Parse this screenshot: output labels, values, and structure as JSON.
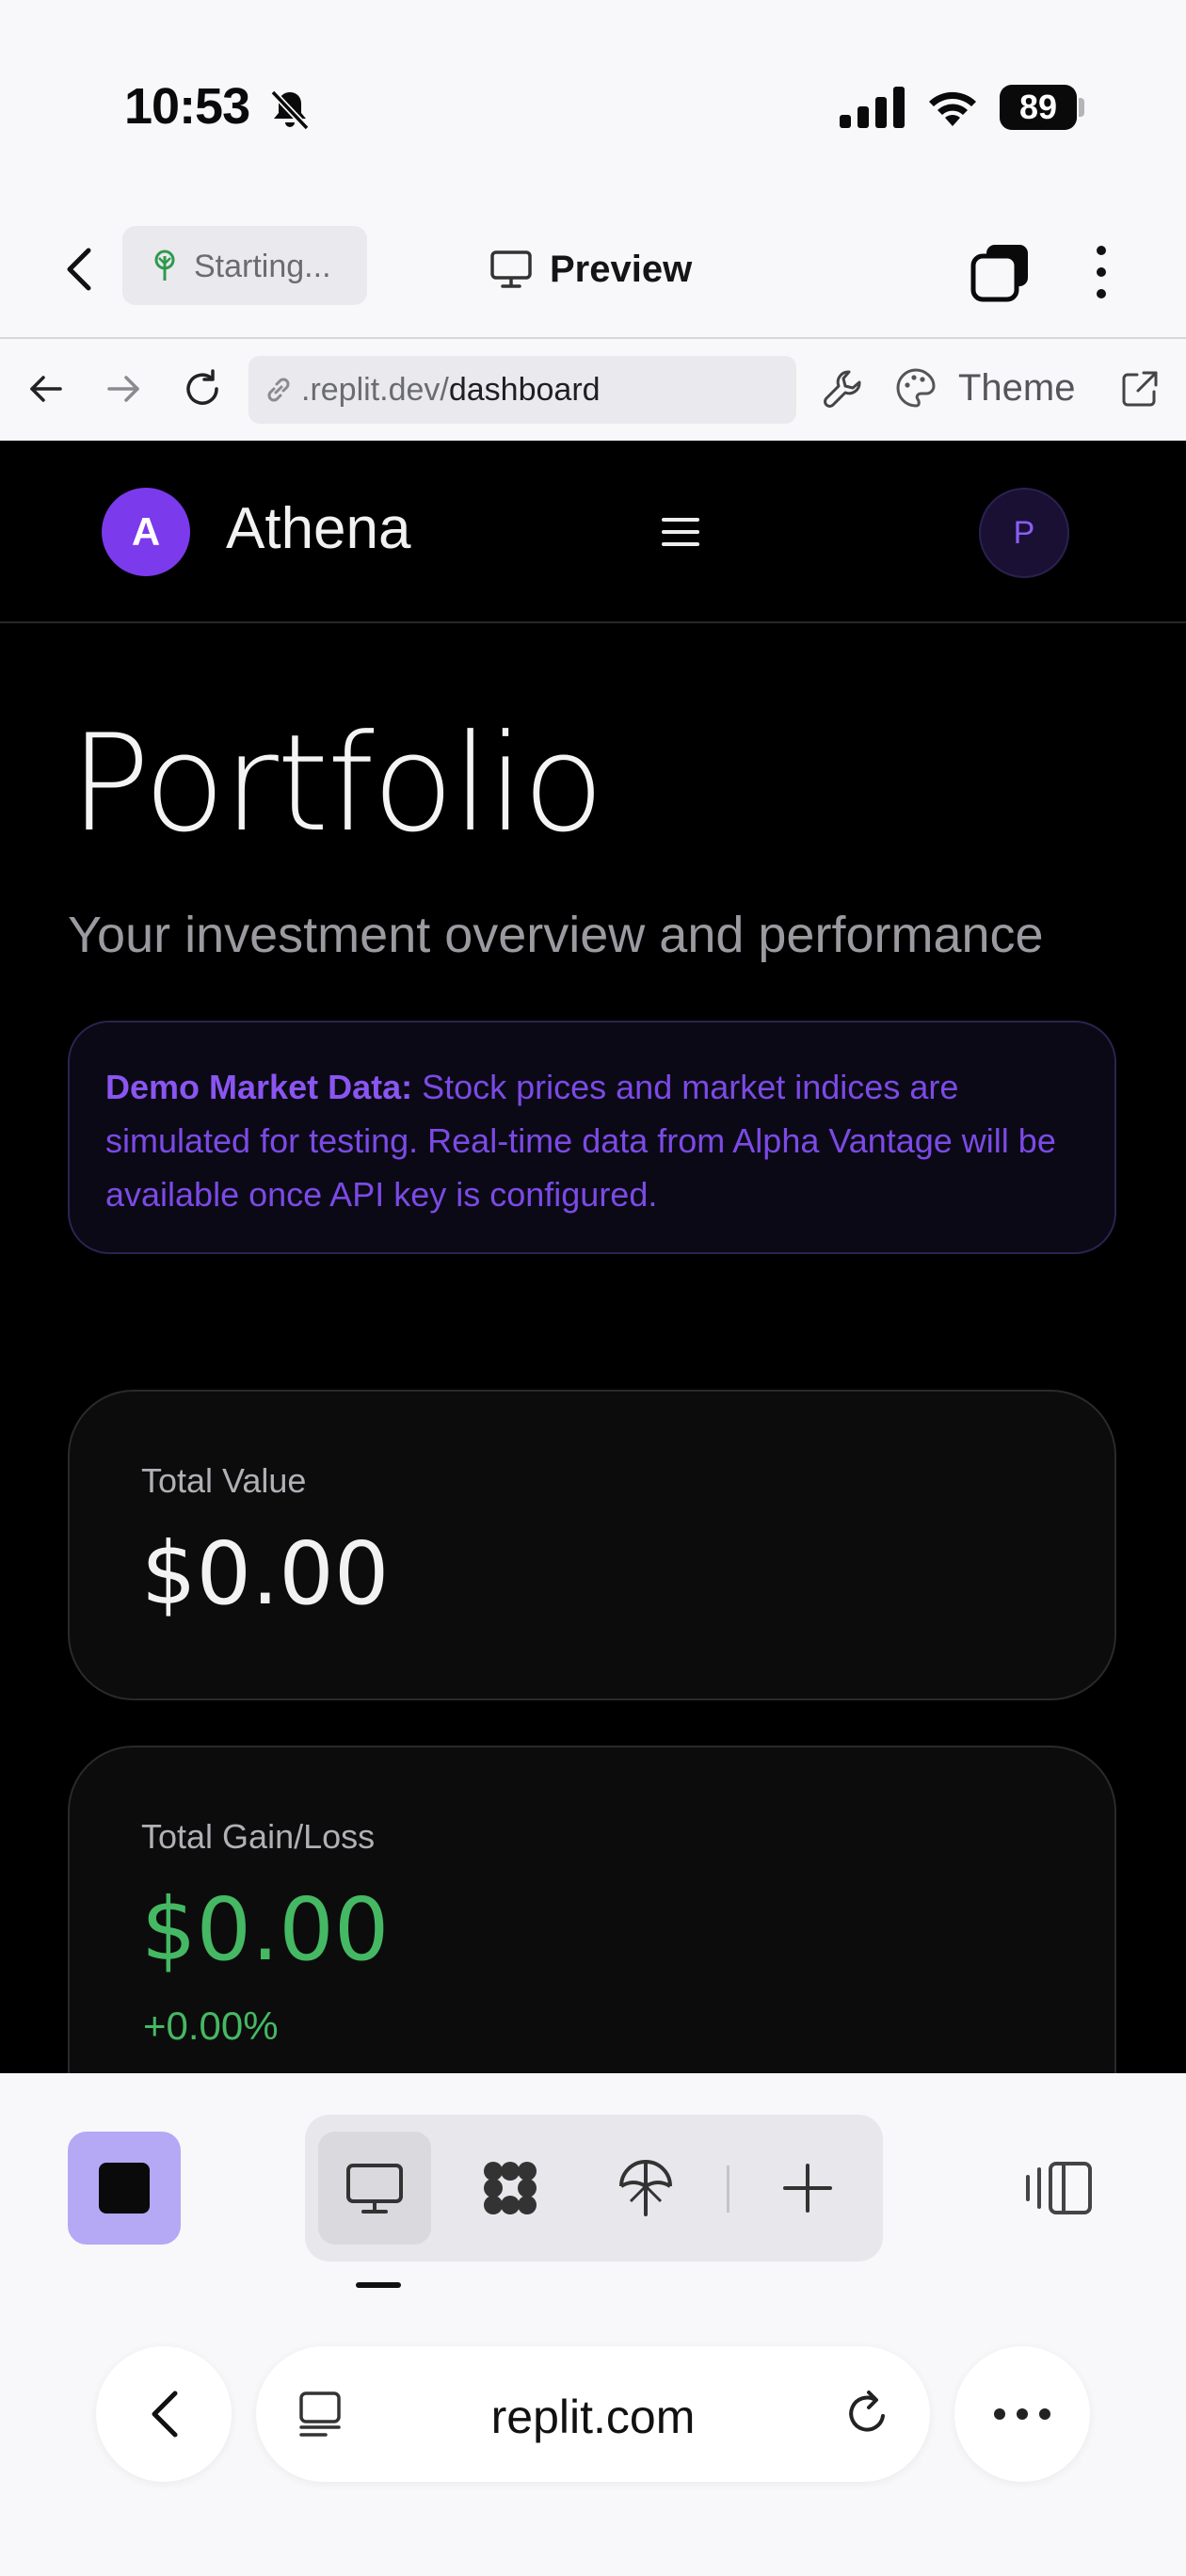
{
  "status_bar": {
    "time": "10:53",
    "battery": "89"
  },
  "replit_header": {
    "status_label": "Starting...",
    "title": "Preview"
  },
  "url_bar": {
    "url_prefix": ".replit.dev/",
    "url_path": "dashboard",
    "theme_label": "Theme"
  },
  "app": {
    "brand_initial": "A",
    "brand_name": "Athena",
    "user_initial": "P",
    "page_title": "Portfolio",
    "page_subtitle": "Your investment overview and performance",
    "banner": {
      "strong": "Demo Market Data:",
      "text": " Stock prices and market indices are simulated for testing. Real-time data from Alpha Vantage will be available once API key is configured."
    },
    "cards": {
      "total_value": {
        "label": "Total Value",
        "value": "$0.00"
      },
      "total_gain": {
        "label": "Total Gain/Loss",
        "value": "$0.00",
        "percent": "+0.00%"
      }
    }
  },
  "bottom_toolbar": {
    "safari_domain": "replit.com"
  },
  "colors": {
    "accent_purple": "#7c3aed",
    "gain_green": "#45b863",
    "stop_button": "#b5a8f5"
  },
  "icons": [
    "bell-slash-icon",
    "signal-icon",
    "wifi-icon",
    "back-chevron-icon",
    "tree-icon",
    "monitor-icon",
    "tabs-icon",
    "kebab-icon",
    "arrow-left-icon",
    "arrow-right-icon",
    "reload-icon",
    "link-icon",
    "wrench-icon",
    "palette-icon",
    "external-link-icon",
    "hamburger-icon",
    "stop-icon",
    "desktop-icon",
    "workspace-icon",
    "deploy-icon",
    "plus-icon",
    "panel-toggle-icon",
    "reader-icon",
    "more-icon"
  ]
}
